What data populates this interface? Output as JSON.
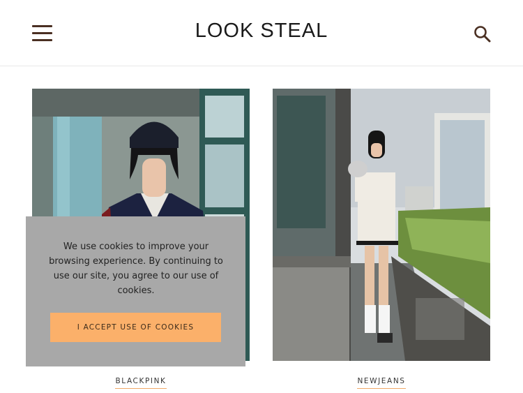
{
  "header": {
    "logo": "LOOK STEAL",
    "menu_icon": "hamburger-menu-icon",
    "search_icon": "search-icon"
  },
  "cards": [
    {
      "caption": "BLACKPINK"
    },
    {
      "caption": "NEWJEANS"
    }
  ],
  "cookie_banner": {
    "message": "We use cookies to improve your browsing experience. By continuing to use our site, you agree to our use of cookies.",
    "accept_label": "I ACCEPT USE OF COOKIES"
  },
  "colors": {
    "accent": "#fbb06a",
    "icon": "#4a2f22",
    "banner_bg": "#a8a8a8",
    "underline": "#f0a868"
  }
}
